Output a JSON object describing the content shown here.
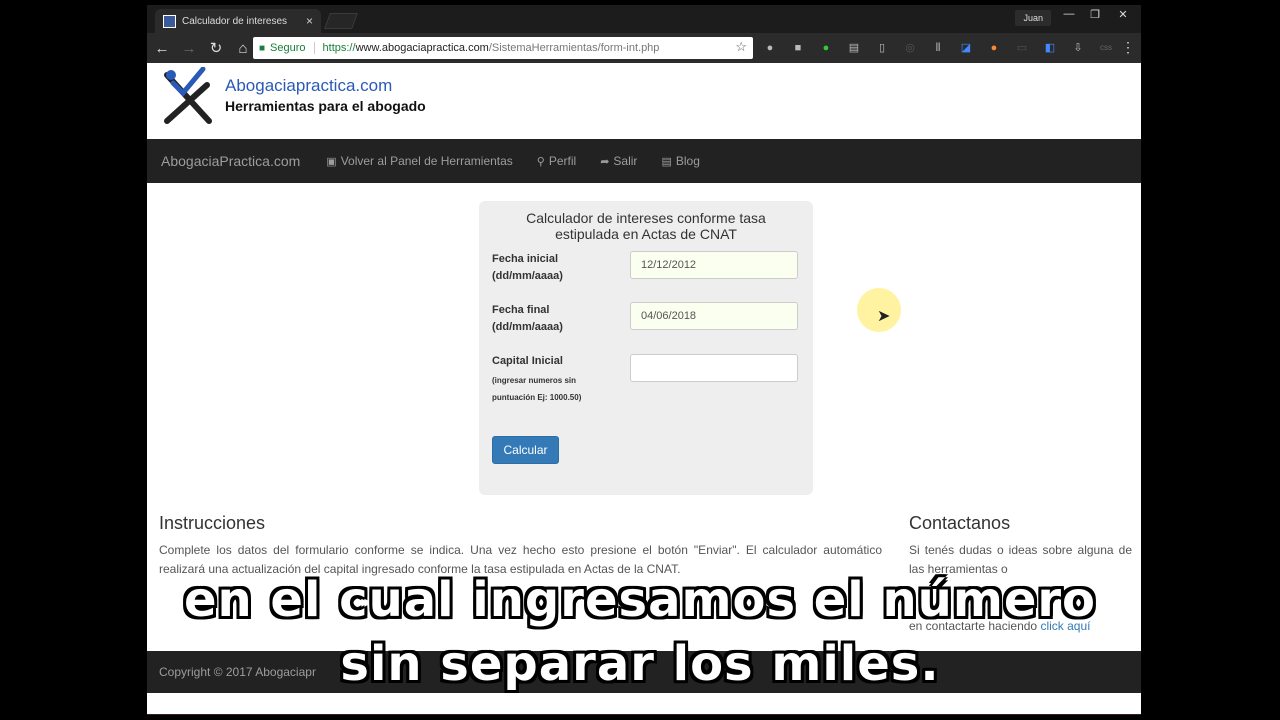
{
  "browser": {
    "tab_title": "Calculador de intereses",
    "tab_close": "×",
    "user": "Juan",
    "window_controls": [
      "—",
      "❐",
      "✕"
    ],
    "secure_label": "Seguro",
    "url_scheme": "https://",
    "url_host": "www.abogaciapractica.com",
    "url_path": "/SistemaHerramientas/form-int.php"
  },
  "site": {
    "name": "Abogaciapractica.com",
    "tagline": "Herramientas para el abogado"
  },
  "navbar": {
    "brand": "AbogaciaPractica.com",
    "links": [
      {
        "label": "Volver al Panel de Herramientas",
        "icon": "briefcase-icon"
      },
      {
        "label": "Perfil",
        "icon": "user-icon"
      },
      {
        "label": "Salir",
        "icon": "sign-out-icon"
      },
      {
        "label": "Blog",
        "icon": "newspaper-icon"
      }
    ]
  },
  "form": {
    "title_line1": "Calculador de intereses conforme tasa",
    "title_line2": "estipulada en Actas de CNAT",
    "fecha_inicial_label": "Fecha inicial",
    "fecha_inicial_format": "(dd/mm/aaaa)",
    "fecha_inicial_value": "12/12/2012",
    "fecha_final_label": "Fecha final",
    "fecha_final_format": "(dd/mm/aaaa)",
    "fecha_final_value": "04/06/2018",
    "capital_label": "Capital Inicial",
    "capital_hint1": "(ingresar numeros sin",
    "capital_hint2": "puntuación Ej: 1000.50)",
    "capital_value": "",
    "submit_label": "Calcular"
  },
  "instrucciones": {
    "title": "Instrucciones",
    "text": "Complete los datos del formulario conforme se indica. Una vez hecho esto presione el botón \"Enviar\". El calculador automático realizará una actualización del capital ingresado conforme la tasa estipulada en Actas de la CNAT."
  },
  "contactanos": {
    "title": "Contactanos",
    "text": "Si tenés dudas o ideas sobre alguna de las herramientas o",
    "text_end": "en contactarte haciendo",
    "link": "click aquí"
  },
  "footer": {
    "text": "Copyright © 2017 Abogaciapr"
  },
  "subtitles": {
    "line1": "en el cual ingresamos el número",
    "line2": "sin separar los miles."
  }
}
